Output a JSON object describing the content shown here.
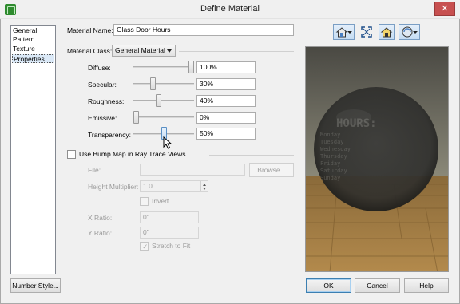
{
  "window": {
    "title": "Define Material",
    "close_glyph": "✕"
  },
  "nav": {
    "items": [
      {
        "label": "General",
        "selected": false
      },
      {
        "label": "Pattern",
        "selected": false
      },
      {
        "label": "Texture",
        "selected": false
      },
      {
        "label": "Properties",
        "selected": true
      }
    ]
  },
  "form": {
    "material_name_label": "Material Name:",
    "material_name_value": "Glass Door Hours",
    "material_class_label": "Material Class:",
    "material_class_value": "General Material",
    "sliders": [
      {
        "label": "Diffuse:",
        "value": "100%",
        "level": 1.0
      },
      {
        "label": "Specular:",
        "value": "30%",
        "level": 0.3
      },
      {
        "label": "Roughness:",
        "value": "40%",
        "level": 0.4
      },
      {
        "label": "Emissive:",
        "value": "0%",
        "level": 0.0
      },
      {
        "label": "Transparency:",
        "value": "50%",
        "level": 0.5
      }
    ],
    "bump_map": {
      "label": "Use Bump Map in Ray Trace Views",
      "checked": false,
      "file_label": "File:",
      "file_value": "",
      "browse_label": "Browse...",
      "height_multiplier_label": "Height Multiplier:",
      "height_multiplier_value": "1.0",
      "invert_label": "Invert",
      "x_ratio_label": "X Ratio:",
      "x_ratio_value": "0\"",
      "y_ratio_label": "Y Ratio:",
      "y_ratio_value": "0\"",
      "stretch_label": "Stretch to Fit",
      "stretch_checked": true
    }
  },
  "toolbar": {
    "icons": [
      "view-options-icon",
      "fit-view-icon",
      "lighting-icon",
      "render-mode-icon"
    ]
  },
  "preview": {
    "sign_heading": "HOURS:",
    "days": [
      "Monday",
      "Tuesday",
      "Wednesday",
      "Thursday",
      "Friday",
      "Saturday",
      "Sunday"
    ]
  },
  "footer": {
    "number_style_label": "Number Style...",
    "ok_label": "OK",
    "cancel_label": "Cancel",
    "help_label": "Help"
  }
}
